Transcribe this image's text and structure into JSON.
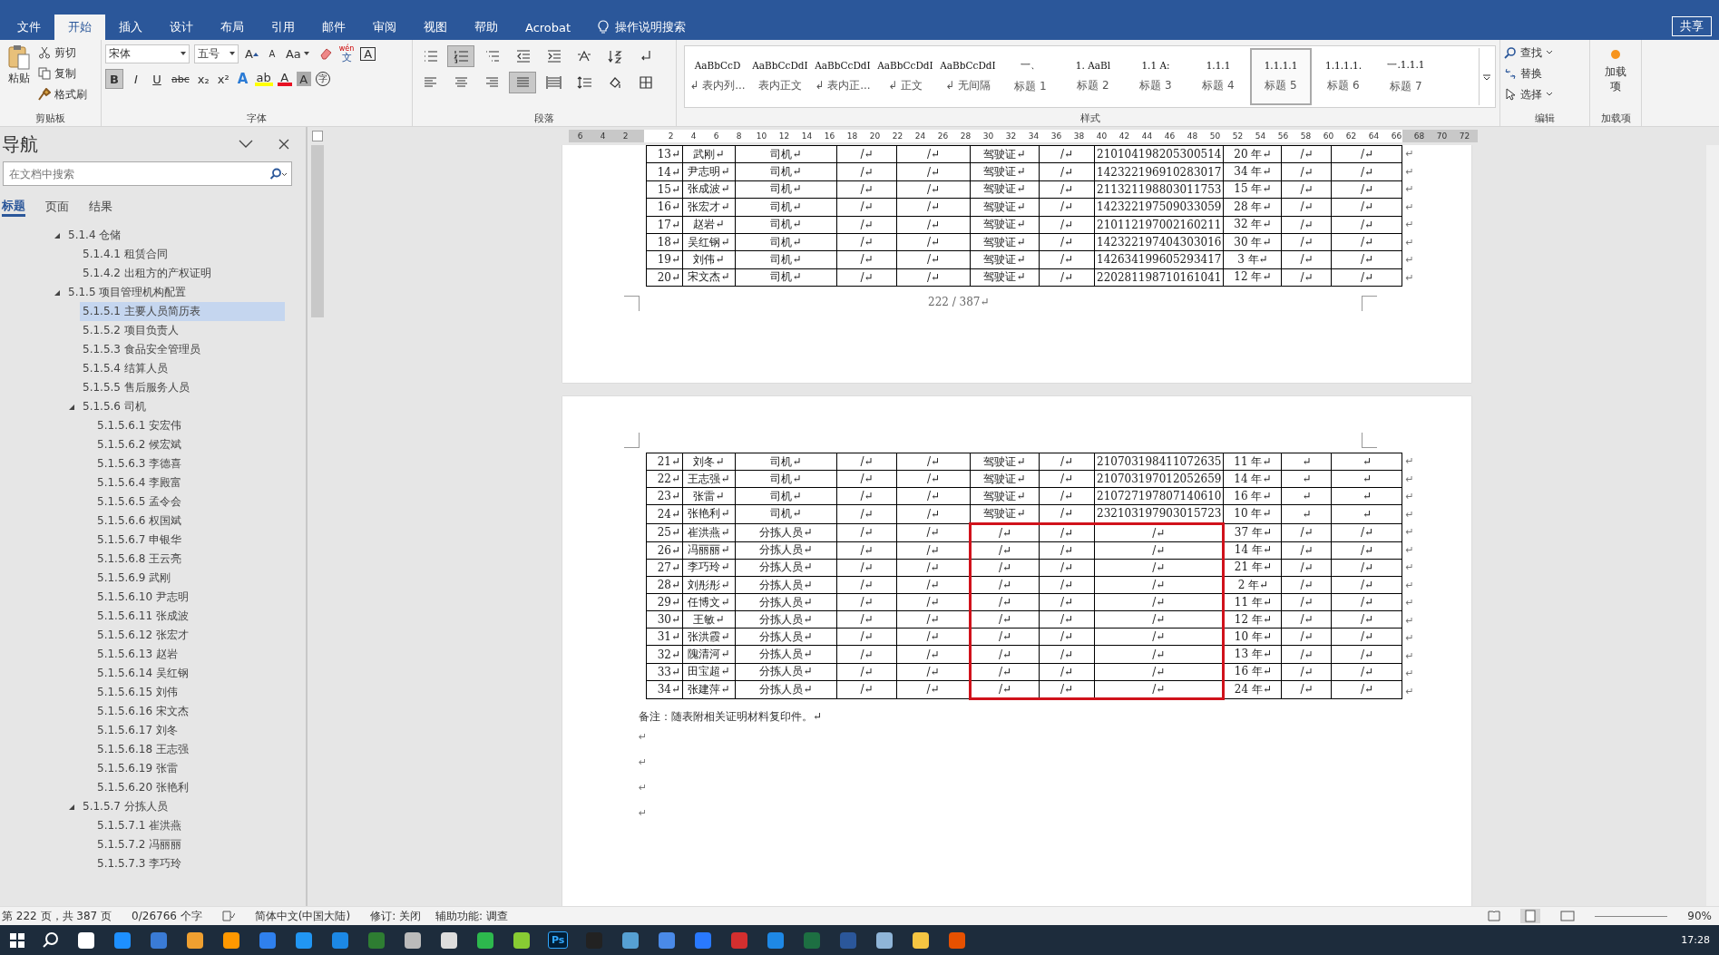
{
  "ribbon_tabs": [
    {
      "label": "文件",
      "selected": false
    },
    {
      "label": "开始",
      "selected": true
    },
    {
      "label": "插入",
      "selected": false
    },
    {
      "label": "设计",
      "selected": false
    },
    {
      "label": "布局",
      "selected": false
    },
    {
      "label": "引用",
      "selected": false
    },
    {
      "label": "邮件",
      "selected": false
    },
    {
      "label": "审阅",
      "selected": false
    },
    {
      "label": "视图",
      "selected": false
    },
    {
      "label": "帮助",
      "selected": false
    },
    {
      "label": "Acrobat",
      "selected": false
    }
  ],
  "tell_me": "操作说明搜索",
  "share": "共享",
  "clipboard": {
    "paste": "粘贴",
    "cut": "剪切",
    "copy": "复制",
    "painter": "格式刷",
    "label": "剪贴板"
  },
  "font": {
    "name": "宋体",
    "size": "五号",
    "case": "Aa",
    "phonetic_top": "wén",
    "phonetic": "文",
    "boxed": "A",
    "grow": "A",
    "shrink": "A",
    "format_buttons": [
      {
        "label": "B",
        "pressed": true
      },
      {
        "label": "I",
        "pressed": false
      },
      {
        "label": "U",
        "pressed": false
      },
      {
        "label": "abc",
        "pressed": false
      },
      {
        "label": "x₂",
        "pressed": false
      },
      {
        "label": "x²",
        "pressed": false
      }
    ],
    "effects": "A",
    "highlight": "ab",
    "color_letter": "A",
    "shade": "A",
    "enclosed": "字",
    "label": "字体"
  },
  "paragraph": {
    "label": "段落",
    "tools": [
      {
        "kind": "bullets",
        "pressed": false
      },
      {
        "kind": "numbering",
        "pressed": true
      },
      {
        "kind": "multilevel",
        "pressed": false
      },
      {
        "kind": "outdent",
        "pressed": false
      },
      {
        "kind": "indent",
        "pressed": false
      },
      {
        "kind": "asian",
        "pressed": false
      },
      {
        "kind": "sort",
        "pressed": false
      },
      {
        "kind": "marks",
        "pressed": false
      },
      {
        "kind": "left",
        "pressed": false
      },
      {
        "kind": "center",
        "pressed": false
      },
      {
        "kind": "right",
        "pressed": false
      },
      {
        "kind": "justify",
        "pressed": true
      },
      {
        "kind": "distributed",
        "pressed": false
      },
      {
        "kind": "spacing",
        "pressed": false
      },
      {
        "kind": "shading",
        "pressed": false
      },
      {
        "kind": "borders",
        "pressed": false
      }
    ]
  },
  "styles": {
    "label": "样式",
    "items": [
      {
        "preview": "AaBbCcD",
        "name": "↲ 表内列...",
        "selected": false
      },
      {
        "preview": "AaBbCcDdI",
        "name": "表内正文",
        "selected": false
      },
      {
        "preview": "AaBbCcDdI",
        "name": "↲ 表内正...",
        "selected": false
      },
      {
        "preview": "AaBbCcDdI",
        "name": "↲ 正文",
        "selected": false
      },
      {
        "preview": "AaBbCcDdI",
        "name": "↲ 无间隔",
        "selected": false
      },
      {
        "preview": "一、",
        "name": "标题 1",
        "selected": false
      },
      {
        "preview": "1.  AaBl",
        "name": "标题 2",
        "selected": false
      },
      {
        "preview": "1.1  A:",
        "name": "标题 3",
        "selected": false
      },
      {
        "preview": "1.1.1",
        "name": "标题 4",
        "selected": false
      },
      {
        "preview": "1.1.1.1",
        "name": "标题 5",
        "selected": true
      },
      {
        "preview": "1.1.1.1.",
        "name": "标题 6",
        "selected": false
      },
      {
        "preview": "一.1.1.1",
        "name": "标题 7",
        "selected": false
      }
    ]
  },
  "editing": {
    "find": "查找",
    "replace": "替换",
    "select": "选择",
    "label": "编辑"
  },
  "addins": {
    "button": "加载项",
    "label": "加载项"
  },
  "navigation": {
    "title": "导航",
    "search_placeholder": "在文档中搜索",
    "tabs": [
      {
        "label": "标题",
        "selected": true
      },
      {
        "label": "页面",
        "selected": false
      },
      {
        "label": "结果",
        "selected": false
      }
    ],
    "tree": [
      {
        "label": "5.1.4  仓储",
        "selected": false,
        "expanded": true,
        "children": [
          {
            "label": "5.1.4.1 租赁合同",
            "selected": false
          },
          {
            "label": "5.1.4.2 出租方的产权证明",
            "selected": false
          }
        ]
      },
      {
        "label": "5.1.5  项目管理机构配置",
        "selected": false,
        "expanded": true,
        "children": [
          {
            "label": "5.1.5.1 主要人员简历表",
            "selected": true
          },
          {
            "label": "5.1.5.2 项目负责人",
            "selected": false
          },
          {
            "label": "5.1.5.3 食品安全管理员",
            "selected": false
          },
          {
            "label": "5.1.5.4 结算人员",
            "selected": false
          },
          {
            "label": "5.1.5.5 售后服务人员",
            "selected": false
          },
          {
            "label": "5.1.5.6 司机",
            "selected": false,
            "expanded": true,
            "children": [
              {
                "label": "5.1.5.6.1 安宏伟",
                "selected": false
              },
              {
                "label": "5.1.5.6.2 候宏斌",
                "selected": false
              },
              {
                "label": "5.1.5.6.3 李德喜",
                "selected": false
              },
              {
                "label": "5.1.5.6.4 李殿富",
                "selected": false
              },
              {
                "label": "5.1.5.6.5 孟令会",
                "selected": false
              },
              {
                "label": "5.1.5.6.6 权国斌",
                "selected": false
              },
              {
                "label": "5.1.5.6.7 申银华",
                "selected": false
              },
              {
                "label": "5.1.5.6.8 王云亮",
                "selected": false
              },
              {
                "label": "5.1.5.6.9 武刚",
                "selected": false
              },
              {
                "label": "5.1.5.6.10 尹志明",
                "selected": false
              },
              {
                "label": "5.1.5.6.11 张成波",
                "selected": false
              },
              {
                "label": "5.1.5.6.12 张宏才",
                "selected": false
              },
              {
                "label": "5.1.5.6.13 赵岩",
                "selected": false
              },
              {
                "label": "5.1.5.6.14 吴红钢",
                "selected": false
              },
              {
                "label": "5.1.5.6.15 刘伟",
                "selected": false
              },
              {
                "label": "5.1.5.6.16 宋文杰",
                "selected": false
              },
              {
                "label": "5.1.5.6.17 刘冬",
                "selected": false
              },
              {
                "label": "5.1.5.6.18 王志强",
                "selected": false
              },
              {
                "label": "5.1.5.6.19 张雷",
                "selected": false
              },
              {
                "label": "5.1.5.6.20 张艳利",
                "selected": false
              }
            ]
          },
          {
            "label": "5.1.5.7 分拣人员",
            "selected": false,
            "expanded": true,
            "children": [
              {
                "label": "5.1.5.7.1 崔洪燕",
                "selected": false
              },
              {
                "label": "5.1.5.7.2 冯丽丽",
                "selected": false
              },
              {
                "label": "5.1.5.7.3 李巧玲",
                "selected": false
              }
            ]
          }
        ]
      }
    ]
  },
  "ruler": [
    "6",
    "4",
    "2",
    "2",
    "4",
    "6",
    "8",
    "10",
    "12",
    "14",
    "16",
    "18",
    "20",
    "22",
    "24",
    "26",
    "28",
    "30",
    "32",
    "34",
    "36",
    "38",
    "40",
    "42",
    "44",
    "46",
    "48",
    "50",
    "52",
    "54",
    "56",
    "58",
    "60",
    "62",
    "64",
    "66",
    "68",
    "70",
    "72"
  ],
  "page1": {
    "rows": [
      {
        "cells": [
          "13↵",
          "武刚↵",
          "司机↵",
          "/↵",
          "/↵",
          "驾驶证↵",
          "/↵",
          "210104198205300514",
          "20 年↵",
          "/↵",
          "/↵"
        ],
        "end": "↵",
        "marked": false
      },
      {
        "cells": [
          "14↵",
          "尹志明↵",
          "司机↵",
          "/↵",
          "/↵",
          "驾驶证↵",
          "/↵",
          "142322196910283017",
          "34 年↵",
          "/↵",
          "/↵"
        ],
        "end": "↵",
        "marked": false
      },
      {
        "cells": [
          "15↵",
          "张成波↵",
          "司机↵",
          "/↵",
          "/↵",
          "驾驶证↵",
          "/↵",
          "211321198803011753",
          "15 年↵",
          "/↵",
          "/↵"
        ],
        "end": "↵",
        "marked": false
      },
      {
        "cells": [
          "16↵",
          "张宏才↵",
          "司机↵",
          "/↵",
          "/↵",
          "驾驶证↵",
          "/↵",
          "142322197509033059",
          "28 年↵",
          "/↵",
          "/↵"
        ],
        "end": "↵",
        "marked": false
      },
      {
        "cells": [
          "17↵",
          "赵岩↵",
          "司机↵",
          "/↵",
          "/↵",
          "驾驶证↵",
          "/↵",
          "210112197002160211",
          "32 年↵",
          "/↵",
          "/↵"
        ],
        "end": "↵",
        "marked": false
      },
      {
        "cells": [
          "18↵",
          "吴红钢↵",
          "司机↵",
          "/↵",
          "/↵",
          "驾驶证↵",
          "/↵",
          "142322197404303016",
          "30 年↵",
          "/↵",
          "/↵"
        ],
        "end": "↵",
        "marked": false
      },
      {
        "cells": [
          "19↵",
          "刘伟↵",
          "司机↵",
          "/↵",
          "/↵",
          "驾驶证↵",
          "/↵",
          "142634199605293417",
          "3 年↵",
          "/↵",
          "/↵"
        ],
        "end": "↵",
        "marked": false
      },
      {
        "cells": [
          "20↵",
          "宋文杰↵",
          "司机↵",
          "/↵",
          "/↵",
          "驾驶证↵",
          "/↵",
          "220281198710161041",
          "12 年↵",
          "/↵",
          "/↵"
        ],
        "end": "↵",
        "marked": false
      }
    ],
    "page_number": "222 / 387↵"
  },
  "page2": {
    "rows": [
      {
        "cells": [
          "21↵",
          "刘冬↵",
          "司机↵",
          "/↵",
          "/↵",
          "驾驶证↵",
          "/↵",
          "210703198411072635",
          "11 年↵",
          "↵",
          "↵"
        ],
        "end": "↵",
        "marked": false
      },
      {
        "cells": [
          "22↵",
          "王志强↵",
          "司机↵",
          "/↵",
          "/↵",
          "驾驶证↵",
          "/↵",
          "210703197012052659",
          "14 年↵",
          "↵",
          "↵"
        ],
        "end": "↵",
        "marked": false
      },
      {
        "cells": [
          "23↵",
          "张雷↵",
          "司机↵",
          "/↵",
          "/↵",
          "驾驶证↵",
          "/↵",
          "210727197807140610",
          "16 年↵",
          "↵",
          "↵"
        ],
        "end": "↵",
        "marked": false
      },
      {
        "cells": [
          "24↵",
          "张艳利↵",
          "司机↵",
          "/↵",
          "/↵",
          "驾驶证↵",
          "/↵",
          "232103197903015723",
          "10 年↵",
          "↵",
          "↵"
        ],
        "end": "↵",
        "marked": false
      },
      {
        "cells": [
          "25↵",
          "崔洪燕↵",
          "分拣人员↵",
          "/↵",
          "/↵",
          "/↵",
          "/↵",
          "/↵",
          "37 年↵",
          "/↵",
          "/↵"
        ],
        "end": "↵",
        "marked": true
      },
      {
        "cells": [
          "26↵",
          "冯丽丽↵",
          "分拣人员↵",
          "/↵",
          "/↵",
          "/↵",
          "/↵",
          "/↵",
          "14 年↵",
          "/↵",
          "/↵"
        ],
        "end": "↵",
        "marked": true
      },
      {
        "cells": [
          "27↵",
          "李巧玲↵",
          "分拣人员↵",
          "/↵",
          "/↵",
          "/↵",
          "/↵",
          "/↵",
          "21 年↵",
          "/↵",
          "/↵"
        ],
        "end": "↵",
        "marked": true
      },
      {
        "cells": [
          "28↵",
          "刘彤彤↵",
          "分拣人员↵",
          "/↵",
          "/↵",
          "/↵",
          "/↵",
          "/↵",
          "2 年↵",
          "/↵",
          "/↵"
        ],
        "end": "↵",
        "marked": true
      },
      {
        "cells": [
          "29↵",
          "任博文↵",
          "分拣人员↵",
          "/↵",
          "/↵",
          "/↵",
          "/↵",
          "/↵",
          "11 年↵",
          "/↵",
          "/↵"
        ],
        "end": "↵",
        "marked": true
      },
      {
        "cells": [
          "30↵",
          "王敏↵",
          "分拣人员↵",
          "/↵",
          "/↵",
          "/↵",
          "/↵",
          "/↵",
          "12 年↵",
          "/↵",
          "/↵"
        ],
        "end": "↵",
        "marked": true
      },
      {
        "cells": [
          "31↵",
          "张洪霞↵",
          "分拣人员↵",
          "/↵",
          "/↵",
          "/↵",
          "/↵",
          "/↵",
          "10 年↵",
          "/↵",
          "/↵"
        ],
        "end": "↵",
        "marked": true
      },
      {
        "cells": [
          "32↵",
          "隗清河↵",
          "分拣人员↵",
          "/↵",
          "/↵",
          "/↵",
          "/↵",
          "/↵",
          "13 年↵",
          "/↵",
          "/↵"
        ],
        "end": "↵",
        "marked": true
      },
      {
        "cells": [
          "33↵",
          "田宝超↵",
          "分拣人员↵",
          "/↵",
          "/↵",
          "/↵",
          "/↵",
          "/↵",
          "16 年↵",
          "/↵",
          "/↵"
        ],
        "end": "↵",
        "marked": true
      },
      {
        "cells": [
          "34↵",
          "张建萍↵",
          "分拣人员↵",
          "/↵",
          "/↵",
          "/↵",
          "/↵",
          "/↵",
          "24 年↵",
          "/↵",
          "/↵"
        ],
        "end": "↵",
        "marked": true
      }
    ],
    "note": "备注：随表附相关证明材料复印件。↵",
    "empty_paragraphs": [
      "↵",
      "↵",
      "↵",
      "↵"
    ]
  },
  "status_bar": {
    "page": "第 222 页，共 387 页",
    "words": "0/26766 个字",
    "language": "简体中文(中国大陆)",
    "track": "修订: 关闭",
    "accessibility": "辅助功能: 调查",
    "zoom": "90%"
  },
  "taskbar": {
    "ps": "Ps",
    "time": "17:28"
  }
}
